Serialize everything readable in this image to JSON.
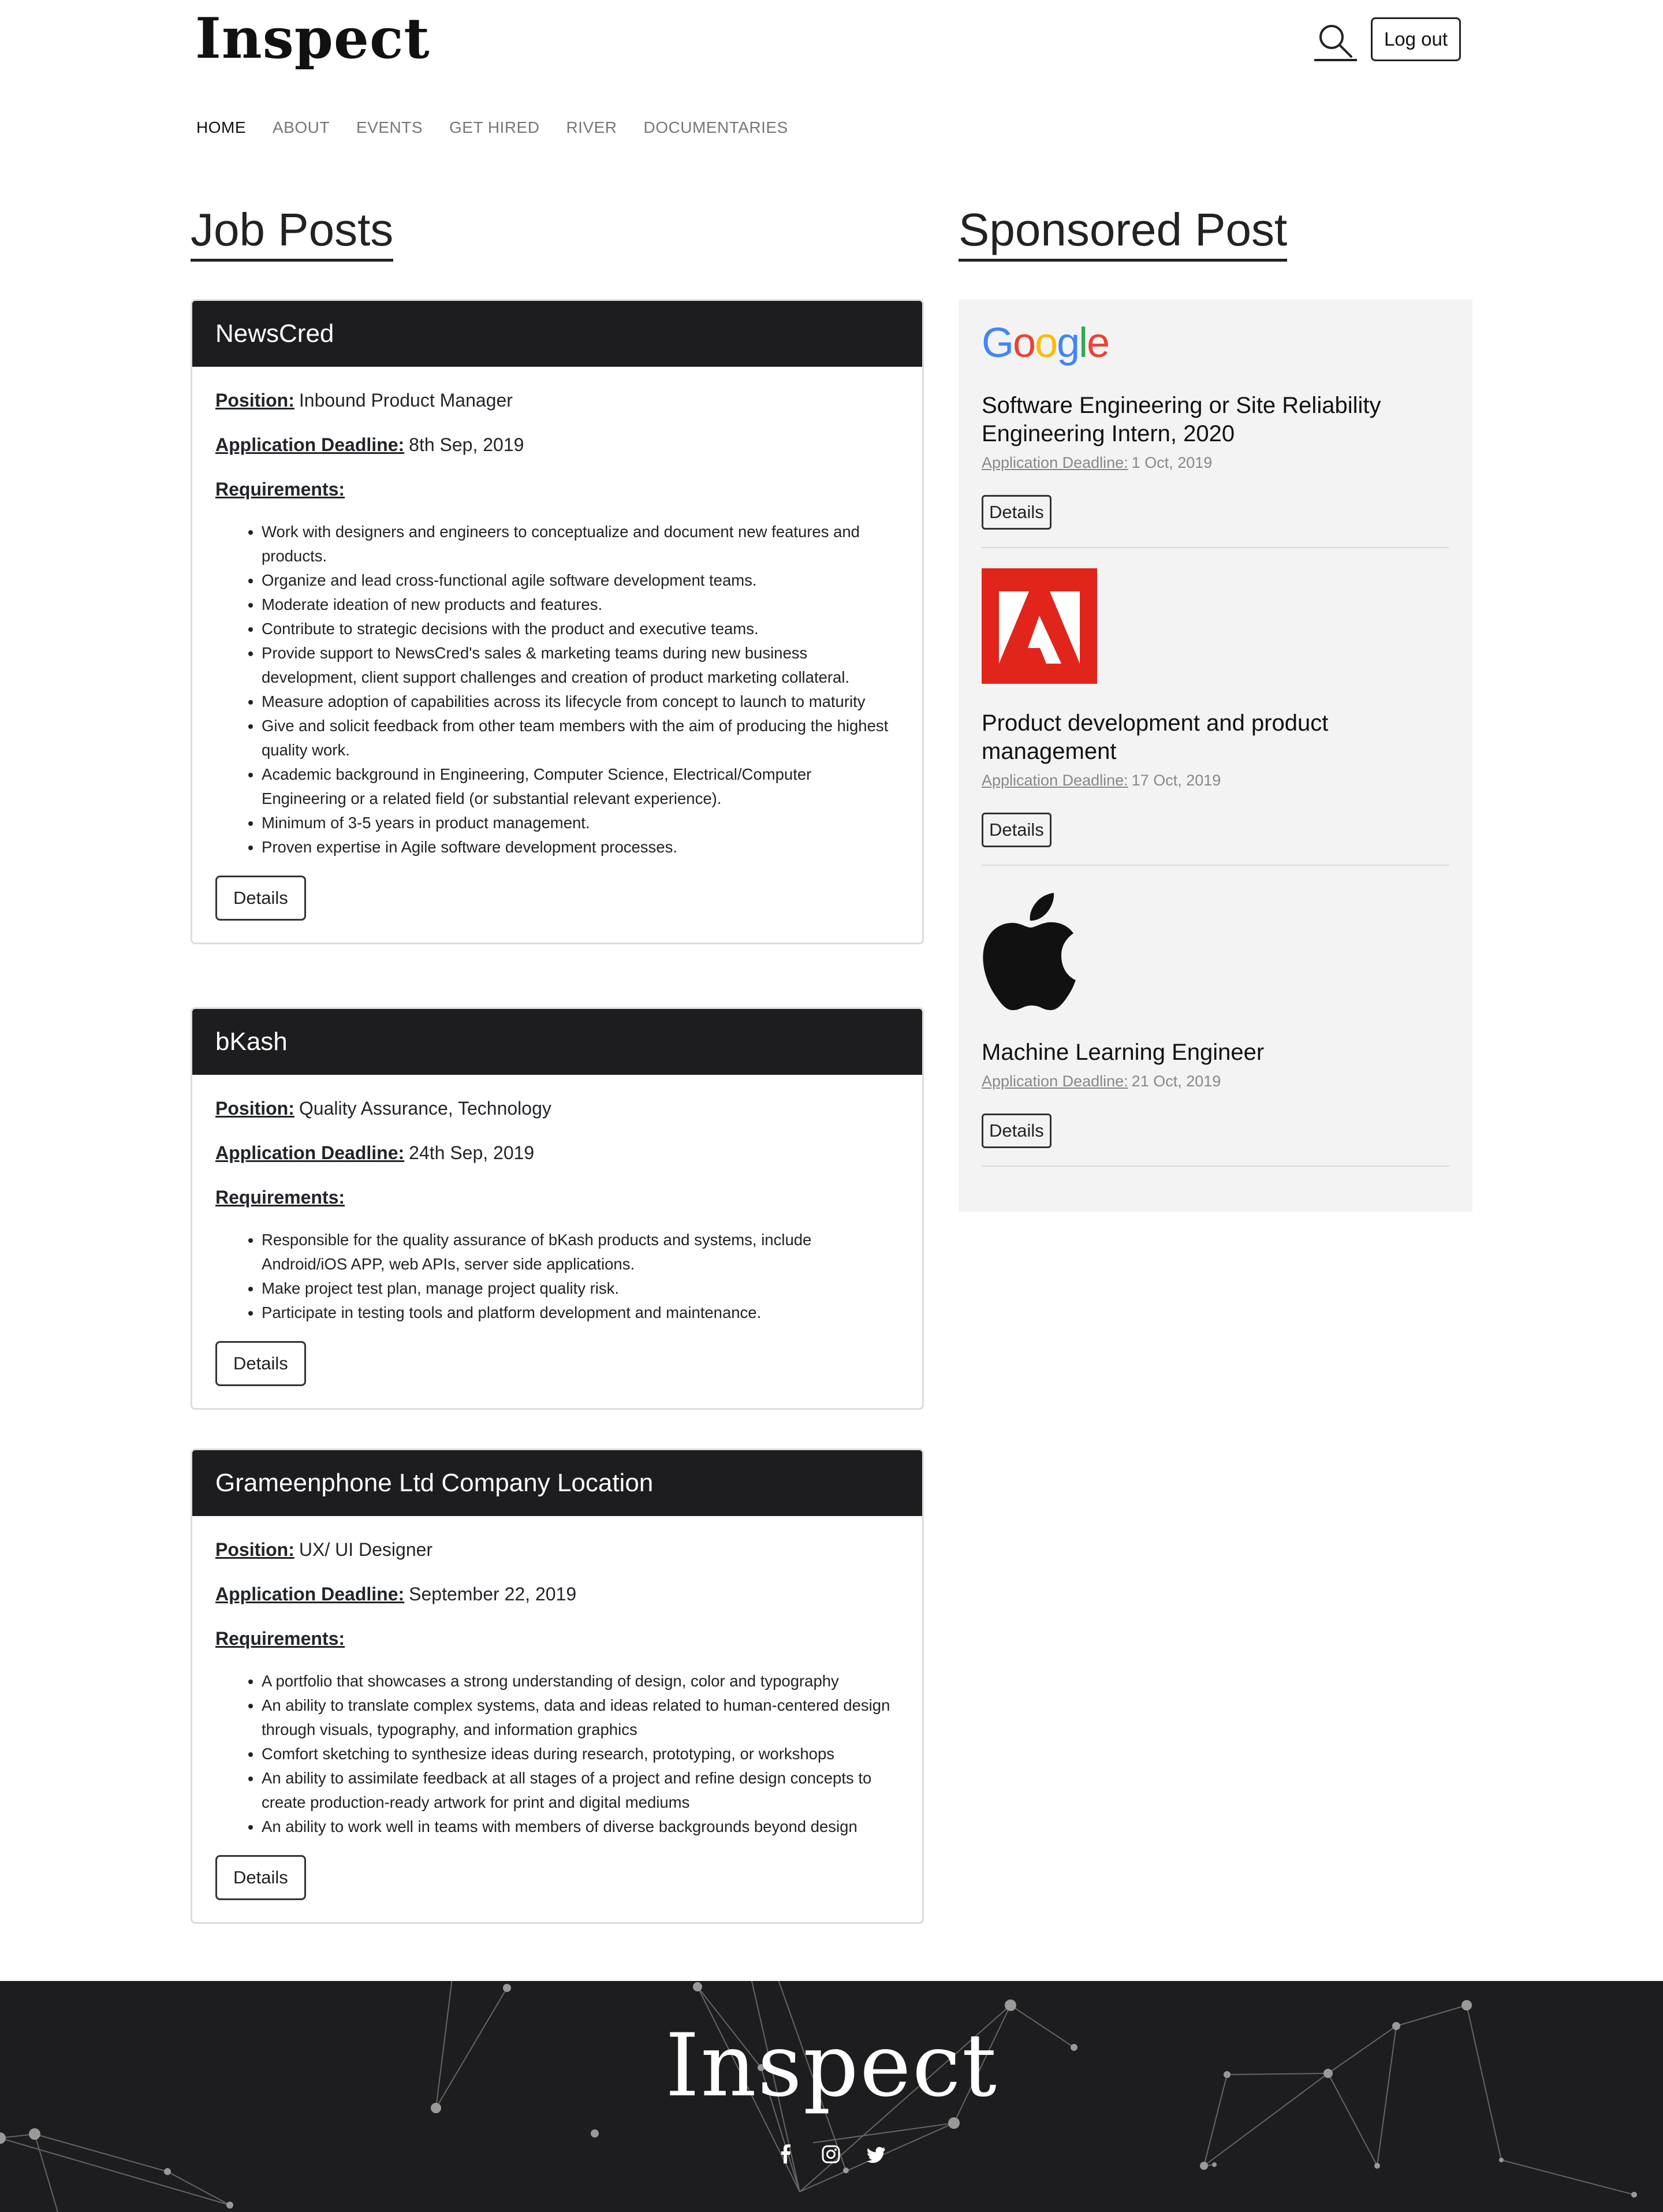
{
  "header": {
    "logo": "Inspect",
    "logout_label": "Log out"
  },
  "nav": {
    "items": [
      "HOME",
      "ABOUT",
      "EVENTS",
      "GET HIRED",
      "RIVER",
      "DOCUMENTARIES"
    ]
  },
  "job_section": {
    "title": "Job Posts",
    "position_label": "Position:",
    "deadline_label": "Application Deadline:",
    "requirements_label": "Requirements:",
    "details_label": "Details",
    "jobs": [
      {
        "company": "NewsCred",
        "position": "Inbound Product Manager",
        "deadline": "8th Sep, 2019",
        "requirements": [
          "Work with designers and engineers to conceptualize and document new features and products.",
          "Organize and lead cross-functional agile software development teams.",
          "Moderate ideation of new products and features.",
          "Contribute to strategic decisions with the product and executive teams.",
          "Provide support to NewsCred's sales & marketing teams during new business development, client support challenges and creation of product marketing collateral.",
          "Measure adoption of capabilities across its lifecycle from concept to launch to maturity",
          "Give and solicit feedback from other team members with the aim of producing the highest quality work.",
          "Academic background in Engineering, Computer Science, Electrical/Computer Engineering or a related field (or substantial relevant experience).",
          "Minimum of 3-5 years in product management.",
          "Proven expertise in Agile software development processes."
        ]
      },
      {
        "company": "bKash",
        "position": "Quality Assurance, Technology",
        "deadline": "24th Sep, 2019",
        "requirements": [
          "Responsible for the quality assurance of bKash products and systems, include Android/iOS APP, web APIs, server side applications.",
          "Make project test plan, manage project quality risk.",
          "Participate in testing tools and platform development and maintenance."
        ]
      },
      {
        "company": "Grameenphone Ltd Company Location",
        "position": "UX/ UI Designer",
        "deadline": "September 22, 2019",
        "requirements": [
          "A portfolio that showcases a strong understanding of design, color and typography",
          "An ability to translate complex systems, data and ideas related to human-centered design through visuals, typography, and information graphics",
          "Comfort sketching to synthesize ideas during research, prototyping, or workshops",
          "An ability to assimilate feedback at all stages of a project and refine design concepts to create production-ready artwork for print and digital mediums",
          "An ability to work well in teams with members of diverse backgrounds beyond design"
        ]
      }
    ]
  },
  "sponsored": {
    "title": "Sponsored Post",
    "deadline_label": "Application Deadline:",
    "details_label": "Details",
    "items": [
      {
        "logo": "google-logo",
        "logo_text": "Google",
        "title": "Software Engineering or Site Reliability Engineering Intern, 2020",
        "deadline": "1 Oct, 2019"
      },
      {
        "logo": "adobe-logo",
        "title": "Product development and product management",
        "deadline": "17 Oct, 2019"
      },
      {
        "logo": "apple-logo",
        "title": "Machine Learning Engineer",
        "deadline": "21 Oct, 2019"
      }
    ]
  },
  "footer": {
    "logo": "Inspect",
    "social": [
      "facebook-icon",
      "instagram-icon",
      "twitter-icon"
    ]
  },
  "colors": {
    "header_bg": "#1d1d1f",
    "sponsored_bg": "#f3f3f3",
    "adobe_red": "#e1251b",
    "footer_bg": "#1d1d1f"
  }
}
